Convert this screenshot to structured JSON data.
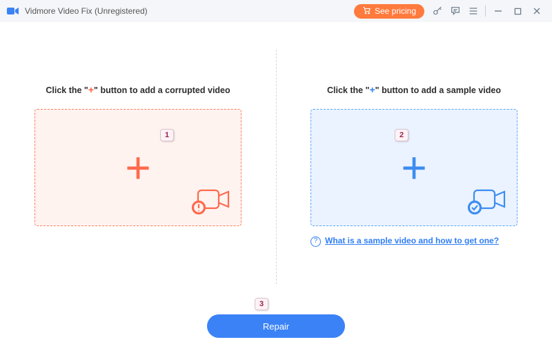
{
  "titlebar": {
    "appTitle": "Vidmore Video Fix (Unregistered)",
    "pricingLabel": "See pricing"
  },
  "left": {
    "label_pre": "Click the \"",
    "label_plus": "+",
    "label_post": "\" button to add a corrupted video"
  },
  "right": {
    "label_pre": "Click the \"",
    "label_plus": "+",
    "label_post": "\" button to add a sample video",
    "helpText": "What is a sample video and how to get one?"
  },
  "repairLabel": "Repair",
  "callouts": {
    "one": "1",
    "two": "2",
    "three": "3"
  }
}
